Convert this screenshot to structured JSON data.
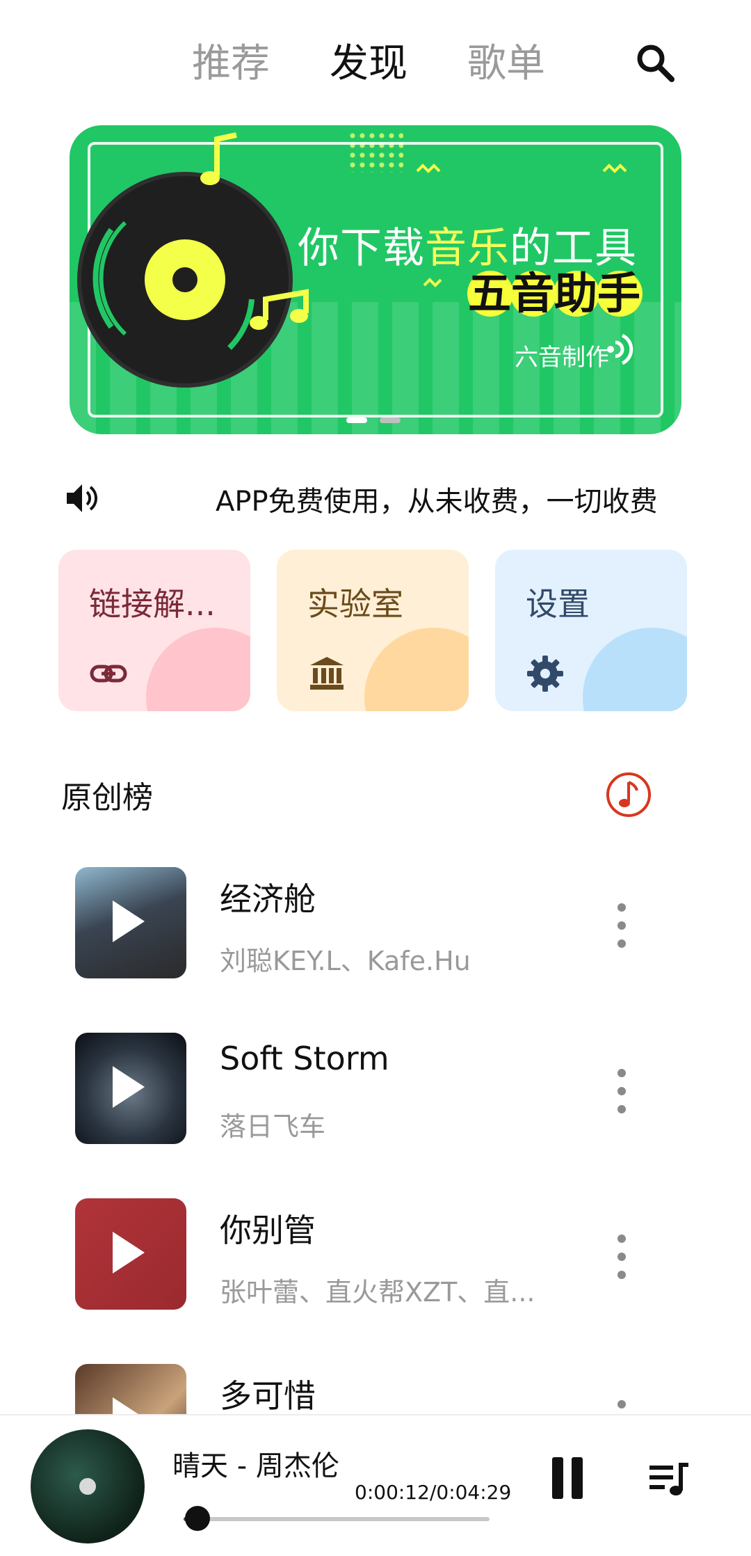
{
  "tabs": [
    {
      "label": "推荐",
      "active": false
    },
    {
      "label": "发现",
      "active": true
    },
    {
      "label": "歌单",
      "active": false
    }
  ],
  "banner": {
    "title_prefix": "你下载",
    "title_highlight": "音乐",
    "title_suffix": "的工具",
    "subtitle": [
      "五",
      "音",
      "助",
      "手"
    ],
    "credit": "六音制作"
  },
  "notice": {
    "text": "APP免费使用，从未收费，一切收费"
  },
  "cards": [
    {
      "label": "链接解...",
      "icon": "link-icon"
    },
    {
      "label": "实验室",
      "icon": "bank-icon"
    },
    {
      "label": "设置",
      "icon": "gear-icon"
    }
  ],
  "section": {
    "title": "原创榜",
    "icon": "music-note-icon"
  },
  "songs": [
    {
      "title": "经济舱",
      "artist": "刘聪KEY.L、Kafe.Hu"
    },
    {
      "title": "Soft Storm",
      "artist": "落日飞车"
    },
    {
      "title": "你别管",
      "artist": "张叶蕾、直火帮XZT、直..."
    },
    {
      "title": "多可惜",
      "artist": ""
    }
  ],
  "player": {
    "title": "晴天 - 周杰伦",
    "time": "0:00:12/0:04:29",
    "progress": 0.045
  },
  "colors": {
    "banner_green": "#21c765",
    "accent_red": "#d9361f"
  }
}
